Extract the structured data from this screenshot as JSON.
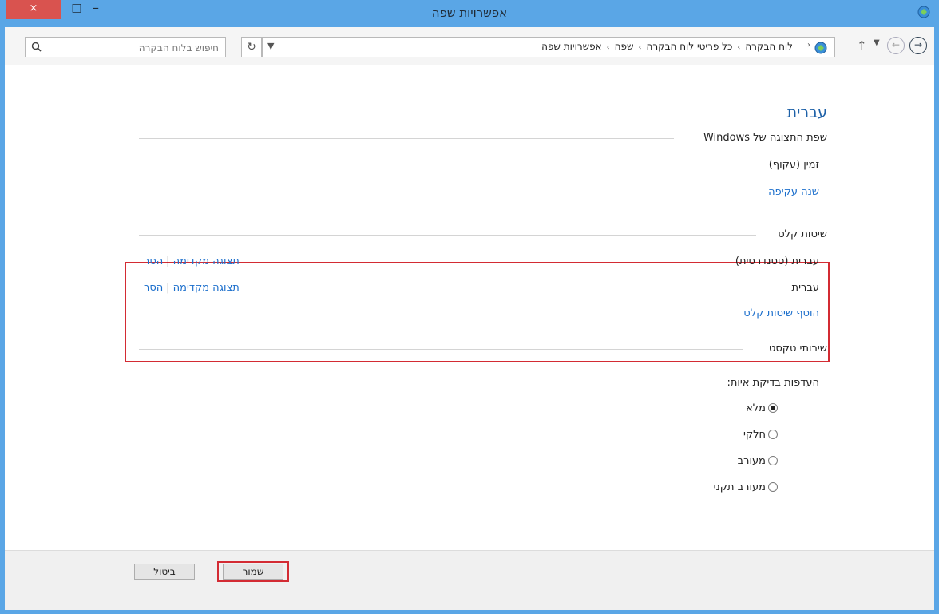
{
  "window": {
    "title": "אפשרויות שפה"
  },
  "titlebar": {
    "close_label": "×",
    "max_label": "□",
    "min_label": "–"
  },
  "address": {
    "search_placeholder": "חיפוש בלוח הבקרה",
    "crumbs": [
      "לוח הבקרה",
      "כל פריטי לוח הבקרה",
      "שפה",
      "אפשרויות שפה"
    ],
    "crumb_sep": "›"
  },
  "page": {
    "title": "עברית"
  },
  "display_language": {
    "header": "שפת התצוגה של Windows",
    "value": "זמין (עקוף)",
    "override_link": "שנה עקיפה"
  },
  "input_methods": {
    "header": "שיטות קלט",
    "items": [
      {
        "name": "עברית (סטנדרטית)",
        "preview": "תצוגה מקדימה",
        "remove": "הסר"
      },
      {
        "name": "עברית",
        "preview": "תצוגה מקדימה",
        "remove": "הסר"
      }
    ],
    "separator": "|",
    "add_link": "הוסף שיטות קלט"
  },
  "text_services": {
    "header": "שירותי טקסט",
    "spelling_label": "העדפות בדיקת איות:",
    "options": [
      {
        "label": "מלא",
        "selected": true
      },
      {
        "label": "חלקי",
        "selected": false
      },
      {
        "label": "מעורב",
        "selected": false
      },
      {
        "label": "מעורב תקני",
        "selected": false
      }
    ]
  },
  "footer": {
    "save_label": "שמור",
    "cancel_label": "ביטול"
  },
  "colors": {
    "titlebar": "#5aa6e6",
    "accent_link": "#1c6fcc",
    "highlight": "#d32b33",
    "heading": "#1e61a8"
  }
}
